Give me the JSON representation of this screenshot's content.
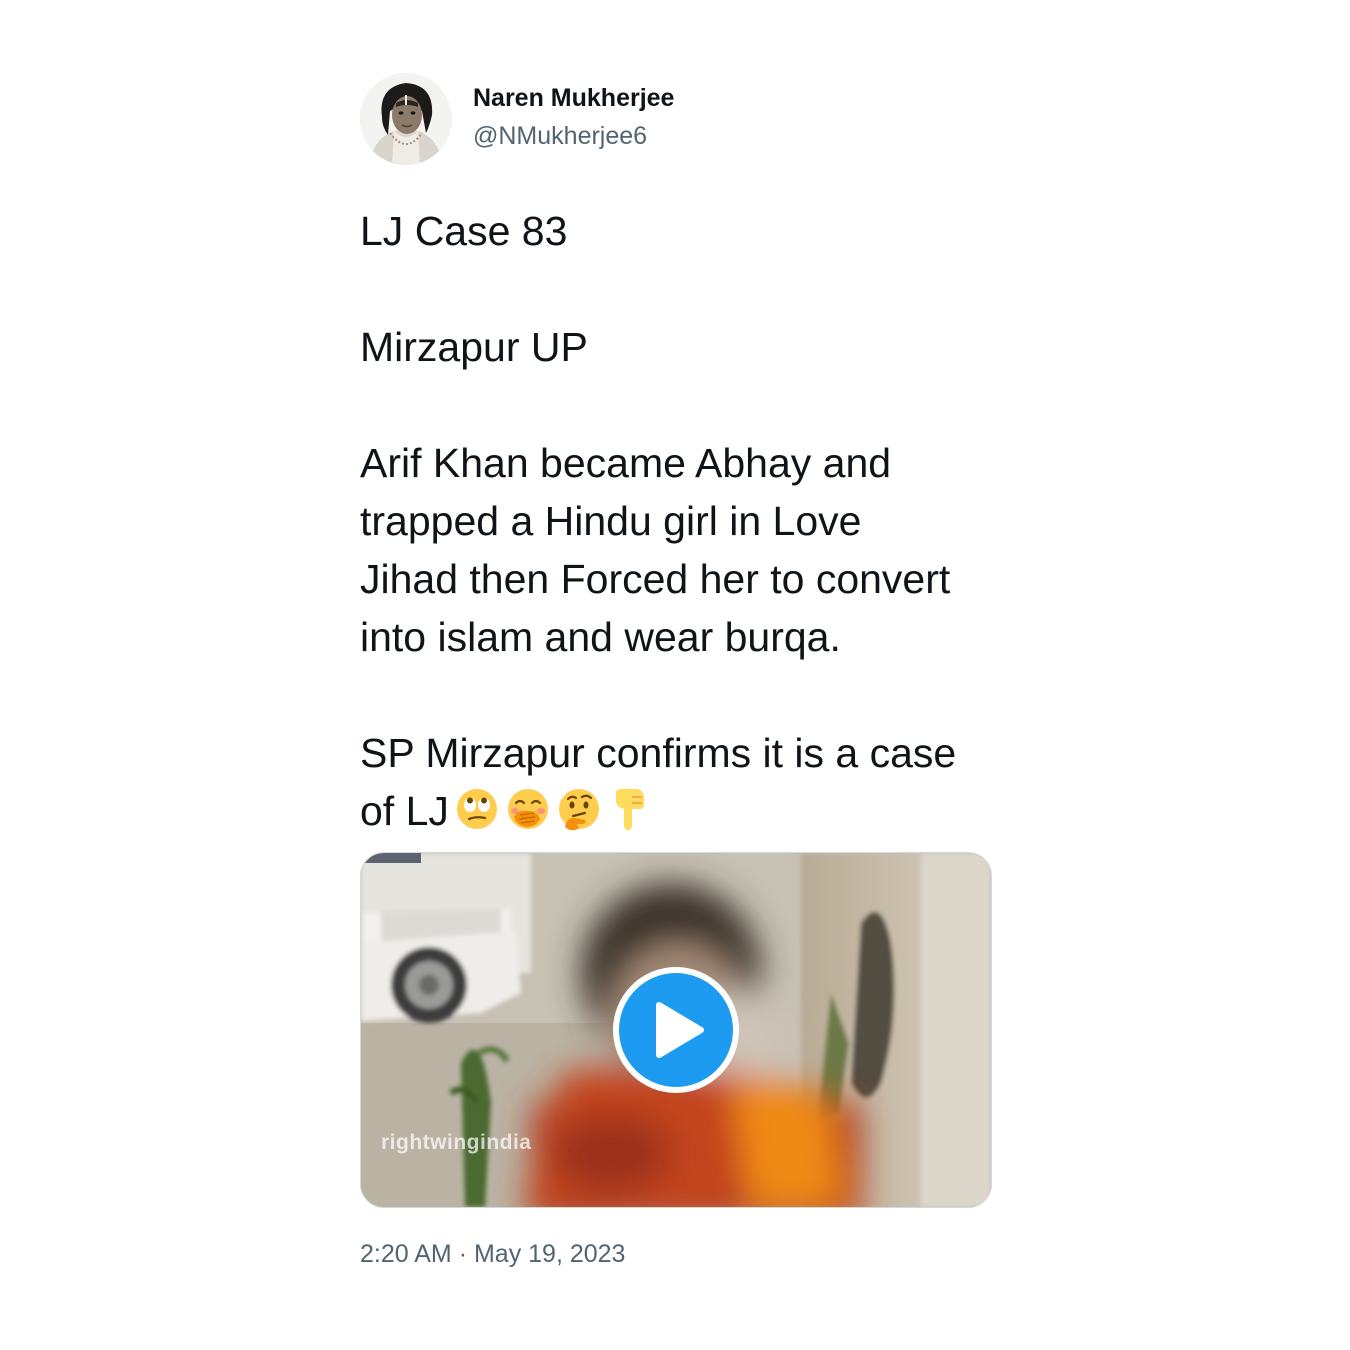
{
  "author": {
    "display_name": "Naren Mukherjee",
    "handle": "@NMukherjee6",
    "avatar_icon": "profile-photo-avatar"
  },
  "tweet": {
    "paragraphs": [
      [
        "LJ Case 83"
      ],
      [
        "Mirzapur UP"
      ],
      [
        "Arif Khan became Abhay and",
        "trapped a Hindu girl in Love",
        "Jihad then Forced her to convert",
        "into islam and wear burqa."
      ],
      [
        "SP Mirzapur confirms it is a case"
      ]
    ],
    "last_line_text": "of LJ",
    "emojis": [
      "face-with-rolling-eyes-emoji",
      "face-with-hand-over-mouth-emoji",
      "thinking-face-emoji",
      "backhand-index-pointing-down-emoji"
    ]
  },
  "media": {
    "type": "video",
    "watermark": "rightwingindia",
    "play_icon": "play-icon",
    "accent_color": "#1d9bf0"
  },
  "timestamp": {
    "time": "2:20 AM",
    "separator": "·",
    "date": "May 19, 2023"
  },
  "colors": {
    "text": "#0f1419",
    "secondary_text": "#536471",
    "background": "#ffffff"
  }
}
